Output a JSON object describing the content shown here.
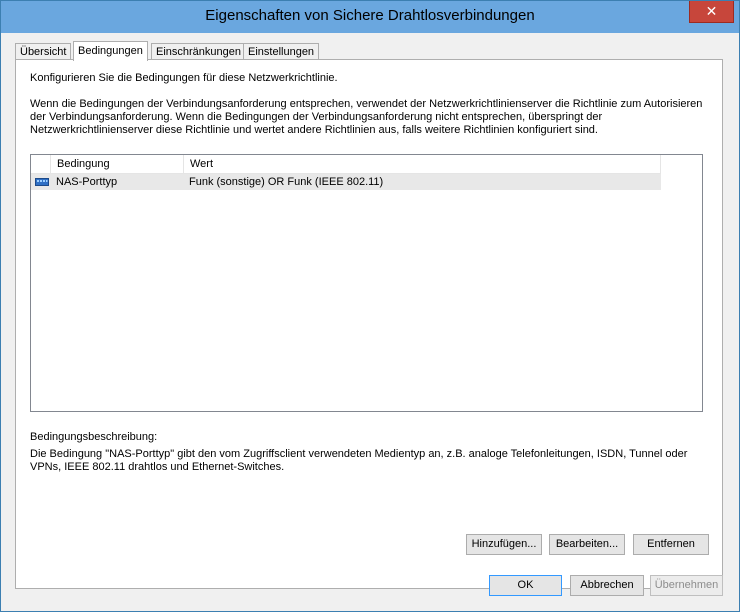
{
  "window": {
    "title": "Eigenschaften von Sichere Drahtlosverbindungen",
    "close_label": "✕"
  },
  "tabs": [
    {
      "label": "Übersicht",
      "active": false
    },
    {
      "label": "Bedingungen",
      "active": true
    },
    {
      "label": "Einschränkungen",
      "active": false
    },
    {
      "label": "Einstellungen",
      "active": false
    }
  ],
  "panel": {
    "intro": "Konfigurieren Sie die Bedingungen für diese Netzwerkrichtlinie.",
    "explanation": "Wenn die Bedingungen der Verbindungsanforderung entsprechen, verwendet der Netzwerkrichtlinienserver die Richtlinie zum Autorisieren der Verbindungsanforderung. Wenn die Bedingungen der Verbindungsanforderung nicht entsprechen, überspringt der Netzwerkrichtlinienserver diese Richtlinie und wertet andere Richtlinien aus, falls weitere Richtlinien konfiguriert sind.",
    "table": {
      "columns": [
        "Bedingung",
        "Wert"
      ],
      "rows": [
        {
          "icon": "network-port-icon",
          "condition": "NAS-Porttyp",
          "value": "Funk (sonstige) OR Funk (IEEE 802.11)"
        }
      ]
    },
    "description_label": "Bedingungsbeschreibung:",
    "description_text": "Die Bedingung \"NAS-Porttyp\" gibt den vom Zugriffsclient verwendeten Medientyp an, z.B. analoge Telefonleitungen, ISDN, Tunnel oder VPNs, IEEE 802.11 drahtlos und Ethernet-Switches.",
    "buttons": {
      "add": "Hinzufügen...",
      "edit": "Bearbeiten...",
      "remove": "Entfernen"
    }
  },
  "footer": {
    "ok": "OK",
    "cancel": "Abbrechen",
    "apply": "Übernehmen"
  },
  "colors": {
    "titlebar": "#6aa7df",
    "close_button": "#c7463b",
    "default_button_border": "#3399ff"
  }
}
